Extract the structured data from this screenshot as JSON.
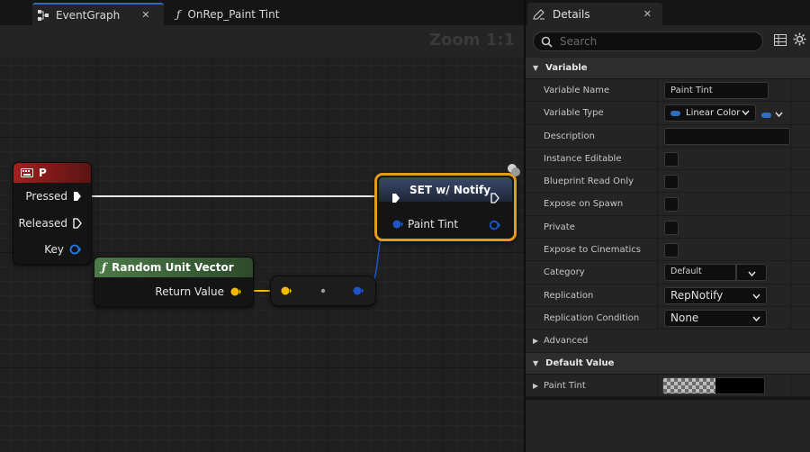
{
  "tabs": [
    {
      "label": "EventGraph",
      "active": true
    },
    {
      "label": "OnRep_Paint Tint",
      "active": false
    }
  ],
  "graph": {
    "zoom_label": "Zoom 1:1",
    "nodes": {
      "input_p": {
        "title": "P",
        "header_color": "#8e1c1c",
        "pins": {
          "pressed": "Pressed",
          "released": "Released",
          "key": "Key"
        }
      },
      "random_unit_vector": {
        "title": "Random Unit Vector",
        "header_color": "#3f6a3c",
        "return_pin": "Return Value"
      },
      "set_notify": {
        "title": "SET w/ Notify",
        "input_pin": "Paint Tint"
      }
    }
  },
  "details": {
    "tab_label": "Details",
    "search_placeholder": "Search",
    "sections": {
      "variable": "Variable",
      "default_value": "Default Value"
    },
    "rows": {
      "variable_name": {
        "label": "Variable Name",
        "value": "Paint Tint"
      },
      "variable_type": {
        "label": "Variable Type",
        "value": "Linear Color",
        "type_color": "#2f6cc2"
      },
      "description": {
        "label": "Description",
        "value": ""
      },
      "instance_editable": {
        "label": "Instance Editable",
        "checked": false
      },
      "blueprint_read_only": {
        "label": "Blueprint Read Only",
        "checked": false
      },
      "expose_on_spawn": {
        "label": "Expose on Spawn",
        "checked": false
      },
      "private": {
        "label": "Private",
        "checked": false
      },
      "expose_to_cinematics": {
        "label": "Expose to Cinematics",
        "checked": false
      },
      "category": {
        "label": "Category",
        "value": "Default"
      },
      "replication": {
        "label": "Replication",
        "value": "RepNotify"
      },
      "replication_condition": {
        "label": "Replication Condition",
        "value": "None"
      },
      "advanced": {
        "label": "Advanced"
      },
      "paint_tint": {
        "label": "Paint Tint"
      }
    }
  },
  "colors": {
    "accent_blue": "#2f6cc2",
    "selection_orange": "#e59a1b",
    "vector_pin": "#f5b800",
    "color_pin": "#1e56c8",
    "exec_wire": "#ffffff"
  }
}
